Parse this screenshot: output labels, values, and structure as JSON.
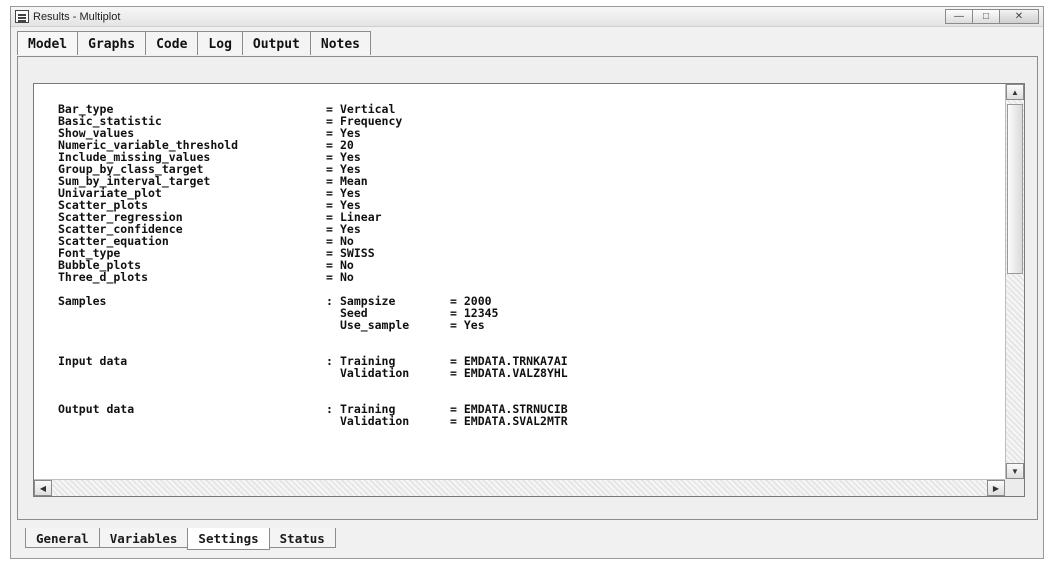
{
  "window": {
    "title": "Results - Multiplot"
  },
  "top_tabs": [
    "Model",
    "Graphs",
    "Code",
    "Log",
    "Output",
    "Notes"
  ],
  "settings": [
    {
      "key": "Bar_type",
      "value": "Vertical"
    },
    {
      "key": "Basic_statistic",
      "value": "Frequency"
    },
    {
      "key": "Show_values",
      "value": "Yes"
    },
    {
      "key": "Numeric_variable_threshold",
      "value": "20"
    },
    {
      "key": "Include_missing_values",
      "value": "Yes"
    },
    {
      "key": "Group_by_class_target",
      "value": "Yes"
    },
    {
      "key": "Sum_by_interval_target",
      "value": "Mean"
    },
    {
      "key": "Univariate_plot",
      "value": "Yes"
    },
    {
      "key": "Scatter_plots",
      "value": "Yes"
    },
    {
      "key": "Scatter_regression",
      "value": "Linear"
    },
    {
      "key": "Scatter_confidence",
      "value": "Yes"
    },
    {
      "key": "Scatter_equation",
      "value": "No"
    },
    {
      "key": "Font_type",
      "value": "SWISS"
    },
    {
      "key": "Bubble_plots",
      "value": "No"
    },
    {
      "key": "Three_d_plots",
      "value": "No"
    }
  ],
  "samples": {
    "label": "Samples",
    "items": [
      {
        "key": "Sampsize",
        "value": "2000"
      },
      {
        "key": "Seed",
        "value": "12345"
      },
      {
        "key": "Use_sample",
        "value": "Yes"
      }
    ]
  },
  "input_data": {
    "label": "Input data",
    "items": [
      {
        "key": "Training",
        "value": "EMDATA.TRNKA7AI"
      },
      {
        "key": "Validation",
        "value": "EMDATA.VALZ8YHL"
      }
    ]
  },
  "output_data": {
    "label": "Output data",
    "items": [
      {
        "key": "Training",
        "value": "EMDATA.STRNUCIB"
      },
      {
        "key": "Validation",
        "value": "EMDATA.SVAL2MTR"
      }
    ]
  },
  "bottom_tabs": [
    "General",
    "Variables",
    "Settings",
    "Status"
  ],
  "active_bottom_tab": "Settings",
  "icons": {
    "window": "window-icon",
    "minimize": "minimize-icon",
    "maximize": "maximize-icon",
    "close": "close-icon",
    "scroll_up": "arrow-up-icon",
    "scroll_down": "arrow-down-icon",
    "scroll_left": "arrow-left-icon",
    "scroll_right": "arrow-right-icon"
  }
}
